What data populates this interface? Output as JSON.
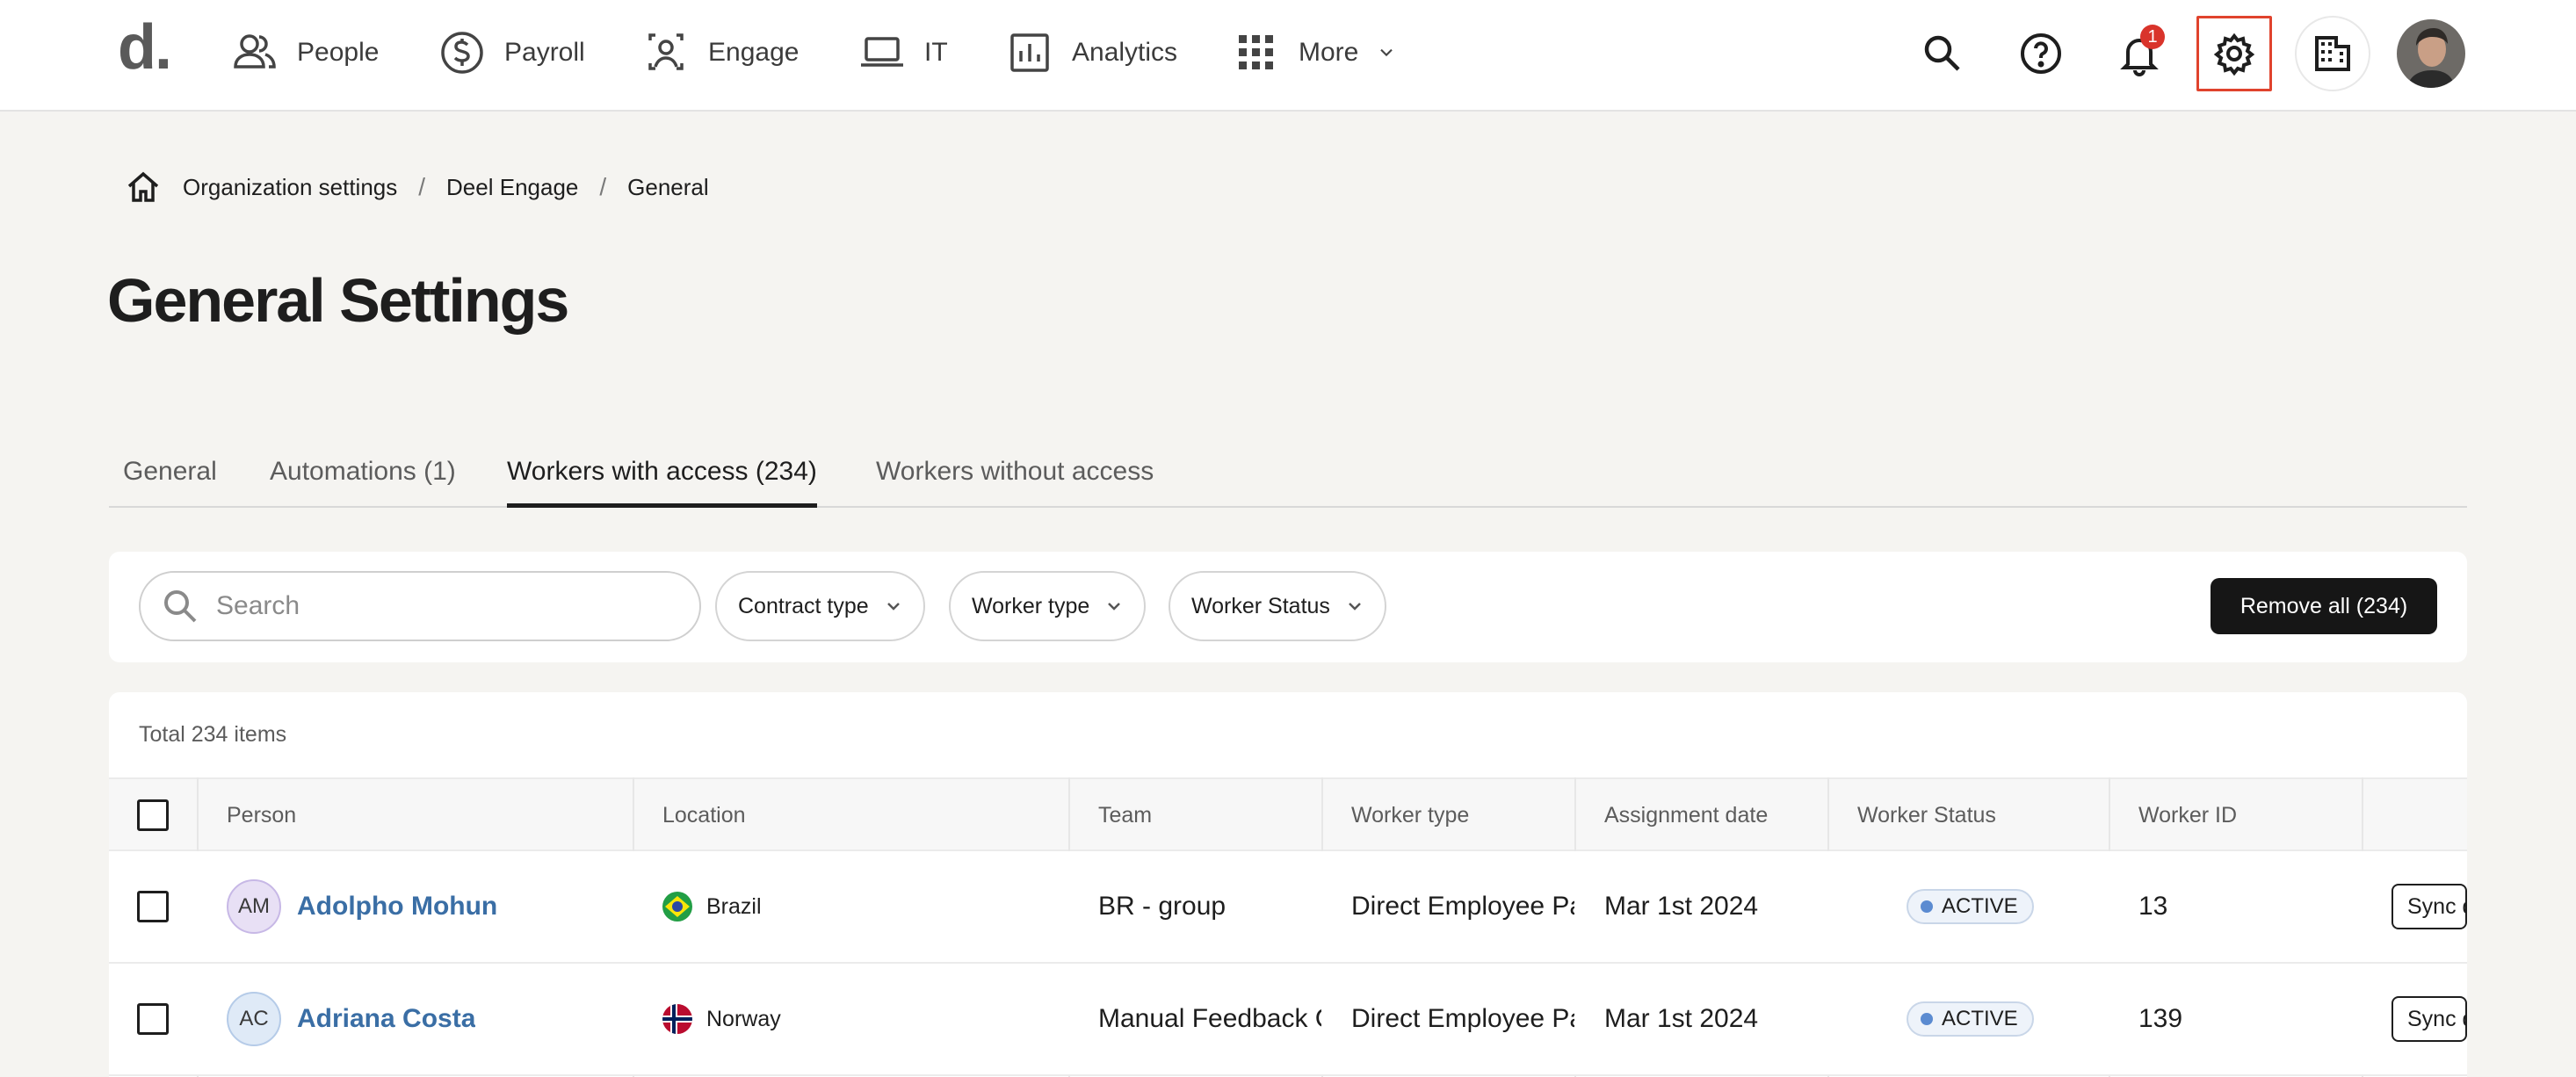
{
  "nav": {
    "logo": "d.",
    "items": [
      {
        "label": "People",
        "icon": "people-icon"
      },
      {
        "label": "Payroll",
        "icon": "dollar-circle-icon"
      },
      {
        "label": "Engage",
        "icon": "engage-icon"
      },
      {
        "label": "IT",
        "icon": "laptop-icon"
      },
      {
        "label": "Analytics",
        "icon": "analytics-icon"
      },
      {
        "label": "More",
        "icon": "grid-icon"
      }
    ],
    "notification_count": "1"
  },
  "breadcrumb": [
    "Organization settings",
    "Deel Engage",
    "General"
  ],
  "page_title": "General Settings",
  "tabs": [
    {
      "label": "General",
      "active": false
    },
    {
      "label": "Automations (1)",
      "active": false
    },
    {
      "label": "Workers with access (234)",
      "active": true
    },
    {
      "label": "Workers without access",
      "active": false
    }
  ],
  "filters": {
    "search_placeholder": "Search",
    "contract_type": "Contract type",
    "worker_type": "Worker type",
    "worker_status": "Worker Status",
    "remove_all": "Remove all (234)"
  },
  "table": {
    "total": "Total 234 items",
    "columns": [
      "Person",
      "Location",
      "Team",
      "Worker type",
      "Assignment date",
      "Worker Status",
      "Worker ID"
    ],
    "rows": [
      {
        "initials": "AM",
        "name": "Adolpho Mohun",
        "avatar_color": "#e8e0f5",
        "location": "Brazil",
        "team": "BR - group",
        "worker_type": "Direct Employee Payroll",
        "assignment_date": "Mar 1st 2024",
        "status": "ACTIVE",
        "worker_id": "13",
        "action": "Sync data"
      },
      {
        "initials": "AC",
        "name": "Adriana Costa",
        "avatar_color": "#dfeaf7",
        "location": "Norway",
        "team": "Manual Feedback Cycle",
        "worker_type": "Direct Employee Payroll",
        "assignment_date": "Mar 1st 2024",
        "status": "ACTIVE",
        "worker_id": "139",
        "action": "Sync data"
      }
    ]
  },
  "colors": {
    "accent_link": "#3a6ea5",
    "highlight_border": "#e0432d",
    "badge_red": "#d9342b",
    "button_dark": "#161616"
  }
}
